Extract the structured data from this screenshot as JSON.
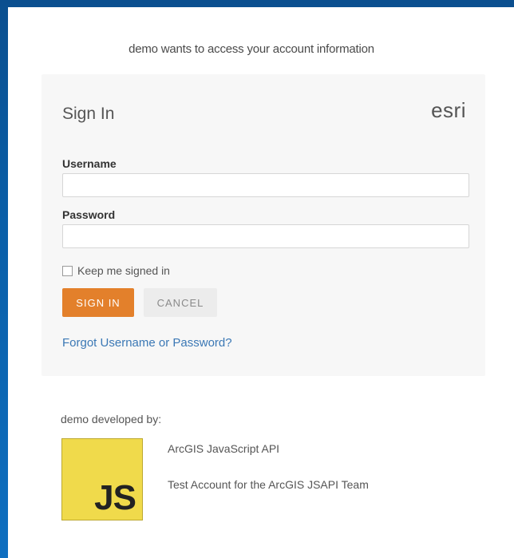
{
  "prompt": "demo wants to access your account information",
  "signin": {
    "title": "Sign In",
    "brand": "esri",
    "username_label": "Username",
    "username_value": "",
    "password_label": "Password",
    "password_value": "",
    "remember_label": "Keep me signed in",
    "remember_checked": false,
    "signin_button": "SIGN IN",
    "cancel_button": "CANCEL",
    "forgot_link": "Forgot Username or Password?"
  },
  "developer": {
    "heading": "demo developed by:",
    "logo_text": "JS",
    "name": "ArcGIS JavaScript API",
    "description": "Test Account for the ArcGIS JSAPI Team"
  },
  "colors": {
    "accent": "#e3802b",
    "link": "#3b78b5",
    "background": "#0a5fa8",
    "logo": "#f0da4b"
  }
}
